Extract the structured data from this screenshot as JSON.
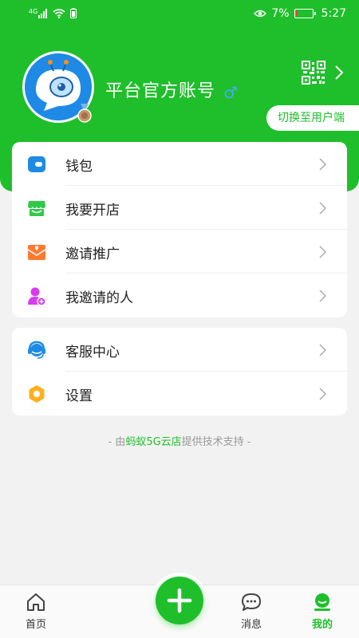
{
  "status": {
    "signal": "4G",
    "battery": "7%",
    "battery_level": 0.07,
    "time": "5:27"
  },
  "profile": {
    "name": "平台官方账号",
    "gender": "♂",
    "switch_label": "切换至用户端"
  },
  "menu_primary": [
    {
      "label": "钱包",
      "icon": "wallet-icon"
    },
    {
      "label": "我要开店",
      "icon": "store-icon"
    },
    {
      "label": "邀请推广",
      "icon": "invite-icon"
    },
    {
      "label": "我邀请的人",
      "icon": "user-add-icon"
    }
  ],
  "menu_secondary": [
    {
      "label": "客服中心",
      "icon": "headset-icon"
    },
    {
      "label": "设置",
      "icon": "settings-icon"
    }
  ],
  "support": {
    "prefix": "- 由",
    "brand": "蚂蚁5G云店",
    "suffix": "提供技术支持 -"
  },
  "tabs": {
    "home": "首页",
    "messages": "消息",
    "mine": "我的"
  },
  "colors": {
    "brand": "#1fbf2b",
    "background": "#f2f2f2"
  }
}
